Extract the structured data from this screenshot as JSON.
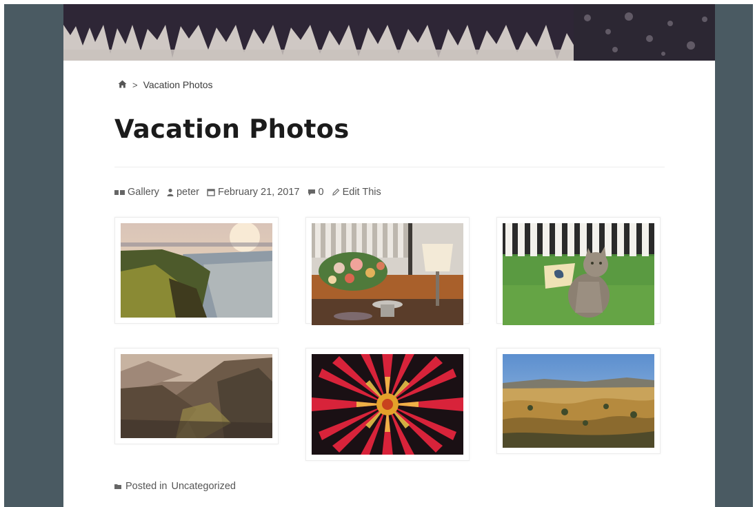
{
  "breadcrumb": {
    "home_icon": "home-icon",
    "separator": ">",
    "current": "Vacation Photos"
  },
  "post": {
    "title": "Vacation Photos",
    "meta": {
      "format": "Gallery",
      "author": "peter",
      "date": "February 21, 2017",
      "comments": "0",
      "edit": "Edit This"
    },
    "gallery": [
      {
        "subject": "coastal cliffs at sunset"
      },
      {
        "subject": "table with flowers and lamp"
      },
      {
        "subject": "cat in grass by white fence"
      },
      {
        "subject": "misty mountain valley"
      },
      {
        "subject": "red dahlia flower"
      },
      {
        "subject": "golden hills landscape"
      }
    ],
    "posted_in_prefix": "Posted in",
    "category": "Uncategorized"
  },
  "colors": {
    "frame": "#4a5a62",
    "title": "#1b1b1b",
    "meta_text": "#555555"
  }
}
